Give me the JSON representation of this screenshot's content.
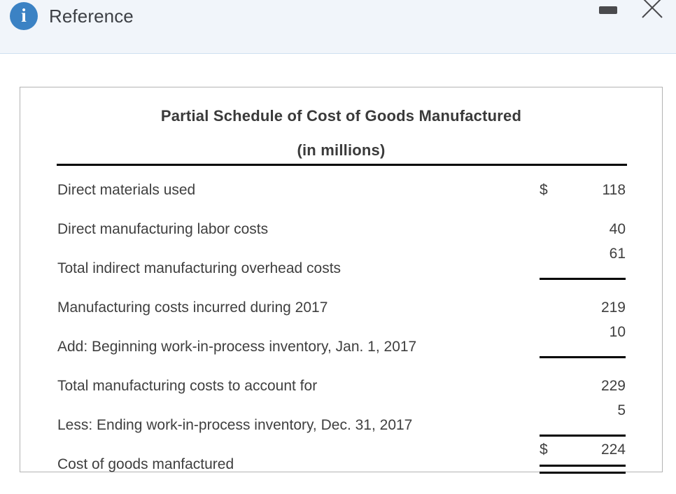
{
  "window": {
    "title": "Reference",
    "icon": "info-icon",
    "accent_color": "#3b82c4",
    "header_background": "#f1f5fa",
    "controls": {
      "minimize_label": "Minimize",
      "close_label": "Close"
    }
  },
  "document": {
    "title": "Partial Schedule of Cost of Goods Manufactured",
    "subtitle": "(in millions)",
    "currency_symbol": "$",
    "rows": [
      {
        "label": "Direct materials used",
        "currency": "$",
        "value": "118",
        "rule": "none"
      },
      {
        "label": "Direct manufacturing labor costs",
        "currency": "",
        "value": "40",
        "rule": "none"
      },
      {
        "label": "Total indirect manufacturing overhead costs",
        "currency": "",
        "value": "61",
        "rule": "single"
      },
      {
        "label": "Manufacturing costs incurred during 2017",
        "currency": "",
        "value": "219",
        "rule": "none"
      },
      {
        "label": "Add: Beginning work-in-process inventory, Jan. 1, 2017",
        "currency": "",
        "value": "10",
        "rule": "single"
      },
      {
        "label": "Total manufacturing costs to account for",
        "currency": "",
        "value": "229",
        "rule": "none"
      },
      {
        "label": "Less: Ending work-in-process inventory, Dec. 31, 2017",
        "currency": "",
        "value": "5",
        "rule": "single"
      },
      {
        "label": "Cost of goods manfactured",
        "currency": "$",
        "value": "224",
        "rule": "double"
      }
    ]
  }
}
